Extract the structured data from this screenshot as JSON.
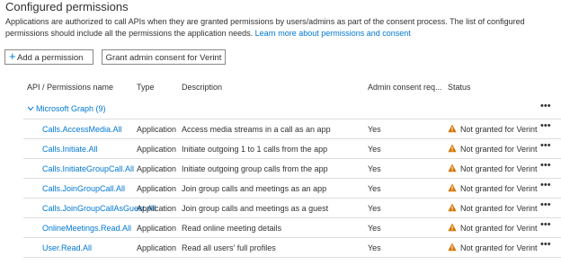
{
  "section": {
    "title": "Configured permissions",
    "description": "Applications are authorized to call APIs when they are granted permissions by users/admins as part of the consent process. The list of configured permissions should include all the permissions the application needs.",
    "learn_more": "Learn more about permissions and consent"
  },
  "toolbar": {
    "add_permission_label": "Add a permission",
    "grant_consent_label": "Grant admin consent for Verint"
  },
  "table": {
    "headers": [
      "API / Permissions name",
      "Type",
      "Description",
      "Admin consent req...",
      "Status"
    ],
    "group": {
      "label": "Microsoft Graph (9)"
    },
    "more_glyph": "•••",
    "rows": [
      {
        "name": "Calls.AccessMedia.All",
        "type": "Application",
        "description": "Access media streams in a call as an app",
        "admin_consent": "Yes",
        "status": "Not granted for Verint"
      },
      {
        "name": "Calls.Initiate.All",
        "type": "Application",
        "description": "Initiate outgoing 1 to 1 calls from the app",
        "admin_consent": "Yes",
        "status": "Not granted for Verint"
      },
      {
        "name": "Calls.InitiateGroupCall.All",
        "type": "Application",
        "description": "Initiate outgoing group calls from the app",
        "admin_consent": "Yes",
        "status": "Not granted for Verint"
      },
      {
        "name": "Calls.JoinGroupCall.All",
        "type": "Application",
        "description": "Join group calls and meetings as an app",
        "admin_consent": "Yes",
        "status": "Not granted for Verint"
      },
      {
        "name": "Calls.JoinGroupCallAsGuest.All",
        "type": "Application",
        "description": "Join group calls and meetings as a guest",
        "admin_consent": "Yes",
        "status": "Not granted for Verint"
      },
      {
        "name": "OnlineMeetings.Read.All",
        "type": "Application",
        "description": "Read online meeting details",
        "admin_consent": "Yes",
        "status": "Not granted for Verint"
      },
      {
        "name": "User.Read.All",
        "type": "Application",
        "description": "Read all users' full profiles",
        "admin_consent": "Yes",
        "status": "Not granted for Verint"
      }
    ]
  },
  "colors": {
    "link": "#0078d4",
    "warning": "#d47500",
    "text": "#323130"
  }
}
